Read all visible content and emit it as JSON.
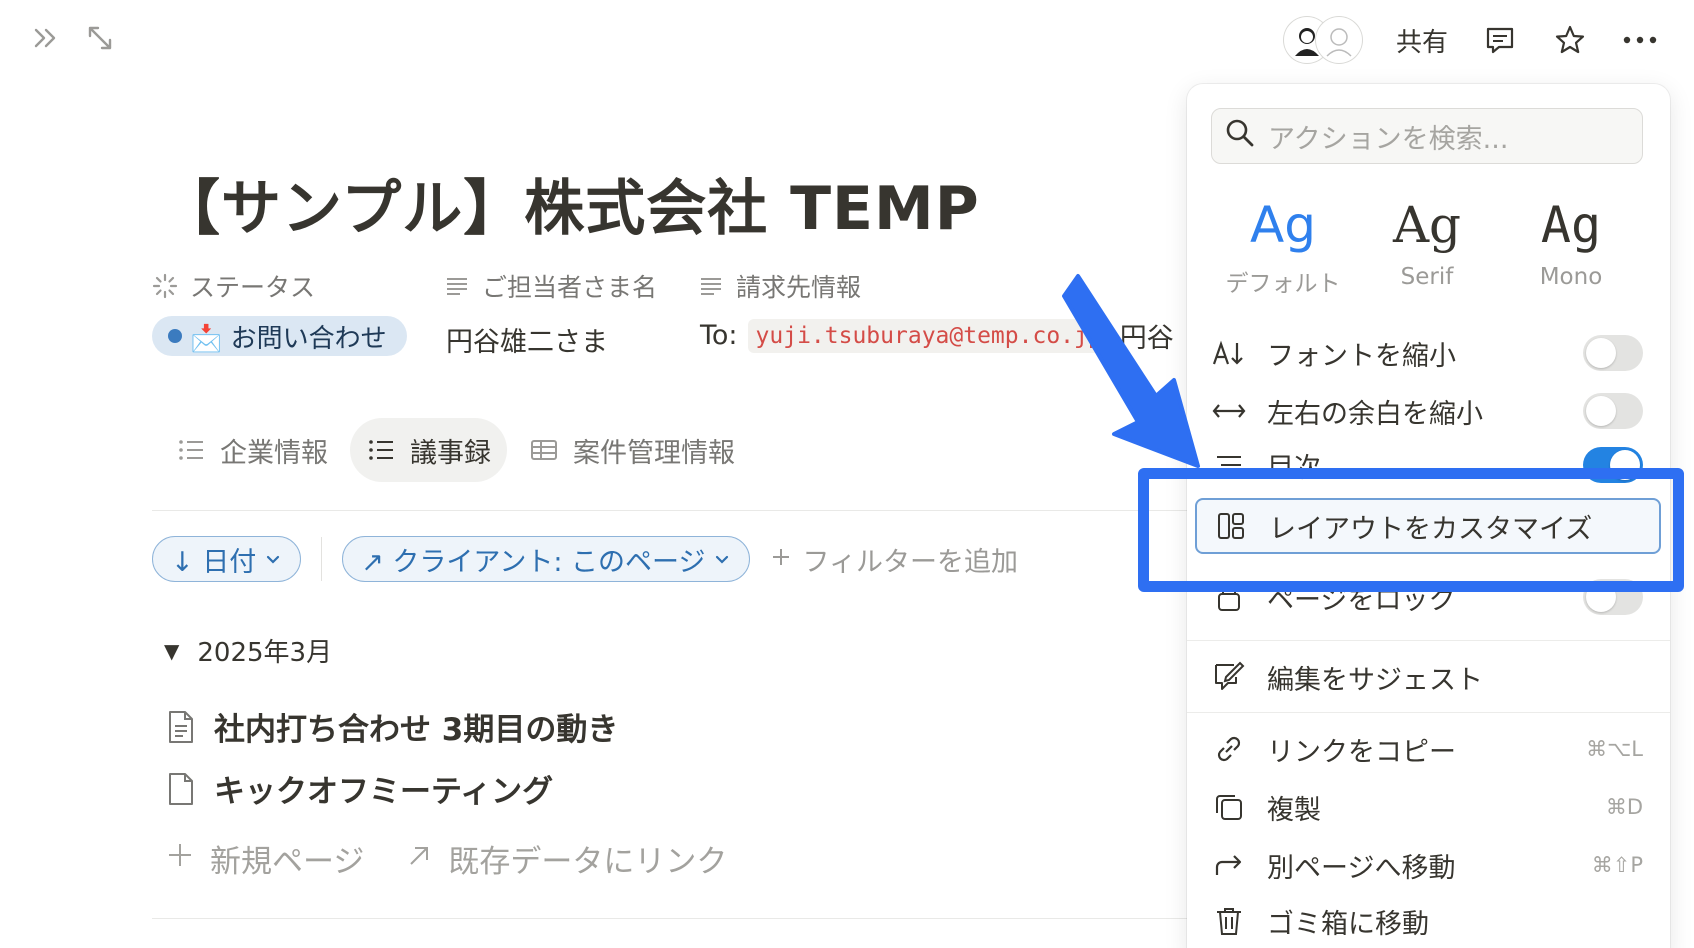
{
  "topbar": {
    "sidebar_icon": "double-chevron-right-icon",
    "expand_icon": "expand-arrows-icon",
    "share_label": "共有",
    "comment_icon": "comment-icon",
    "favorite_icon": "star-icon",
    "more_icon": "more-dots-icon"
  },
  "page": {
    "title": "【サンプル】株式会社 TEMP"
  },
  "properties": {
    "status_label": "ステータス",
    "contact_label": "ご担当者さま名",
    "billing_label": "請求先情報",
    "status_value": "📩 お問い合わせ",
    "contact_value": "円谷雄二さま",
    "billing_prefix": "To:",
    "billing_email": "yuji.tsuburaya@temp.co.jp",
    "billing_suffix": "円谷"
  },
  "tabs": [
    {
      "label": "企業情報"
    },
    {
      "label": "議事録"
    },
    {
      "label": "案件管理情報"
    }
  ],
  "filters": {
    "sort_label": "↓ 日付",
    "client_label": "↗ クライアント: このページ",
    "add_filter": "フィルターを追加"
  },
  "group": {
    "label": "2025年3月"
  },
  "rows": [
    {
      "title": "社内打ち合わせ 3期目の動き"
    },
    {
      "title": "キックオフミーティング"
    }
  ],
  "new_row": {
    "new_page": "新規ページ",
    "link_existing": "既存データにリンク"
  },
  "menu": {
    "search_placeholder": "アクションを検索...",
    "fonts": [
      {
        "sample": "Ag",
        "name": "デフォルト",
        "selected": true
      },
      {
        "sample": "Ag",
        "name": "Serif",
        "selected": false
      },
      {
        "sample": "Ag",
        "name": "Mono",
        "selected": false
      }
    ],
    "small_text": "フォントを縮小",
    "full_width": "左右の余白を縮小",
    "toc": "目次",
    "customize_layout": "レイアウトをカスタマイズ",
    "lock_page": "ページをロック",
    "suggest_edits": "編集をサジェスト",
    "copy_link": "リンクをコピー",
    "copy_link_shortcut": "⌘⌥L",
    "duplicate": "複製",
    "duplicate_shortcut": "⌘D",
    "move_to": "別ページへ移動",
    "move_to_shortcut": "⌘⇧P",
    "trash": "ゴミ箱に移動",
    "toggle_states": {
      "small_text": false,
      "full_width": false,
      "toc": true,
      "lock_page": false
    }
  },
  "colors": {
    "accent": "#2383e2",
    "callout": "#2e6ff2",
    "status_pill": "#dbe7f3",
    "code_text": "#d44c47"
  }
}
